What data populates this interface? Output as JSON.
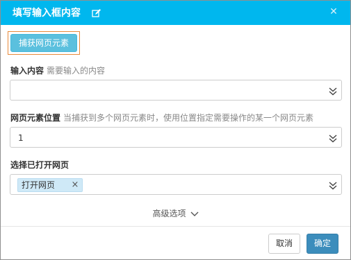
{
  "dialog": {
    "title": "填写输入框内容",
    "close_glyph": "✕"
  },
  "capture": {
    "label": "捕获网页元素"
  },
  "input_content": {
    "label": "输入内容",
    "hint": "需要输入的内容",
    "value": ""
  },
  "element_position": {
    "label": "网页元素位置",
    "hint": "当捕获到多个网页元素时，使用位置指定需要操作的某一个网页元素",
    "value": "1"
  },
  "opened_page": {
    "label": "选择已打开网页",
    "tag_label": "打开网页",
    "tag_close": "×"
  },
  "advanced": {
    "label": "高级选项"
  },
  "footer": {
    "cancel_label": "取消",
    "ok_label": "确定"
  },
  "colors": {
    "titlebar": "#00b7ee",
    "capture_button": "#5bc0de",
    "ok_button": "#3c8dbc",
    "tag_background": "#cfe9f7",
    "highlight_border": "#e88a3a"
  },
  "icons": {
    "title": "edit-icon",
    "close": "close-icon",
    "field_dropdown": "double-chevron-down-icon",
    "advanced": "chevron-down-icon"
  }
}
